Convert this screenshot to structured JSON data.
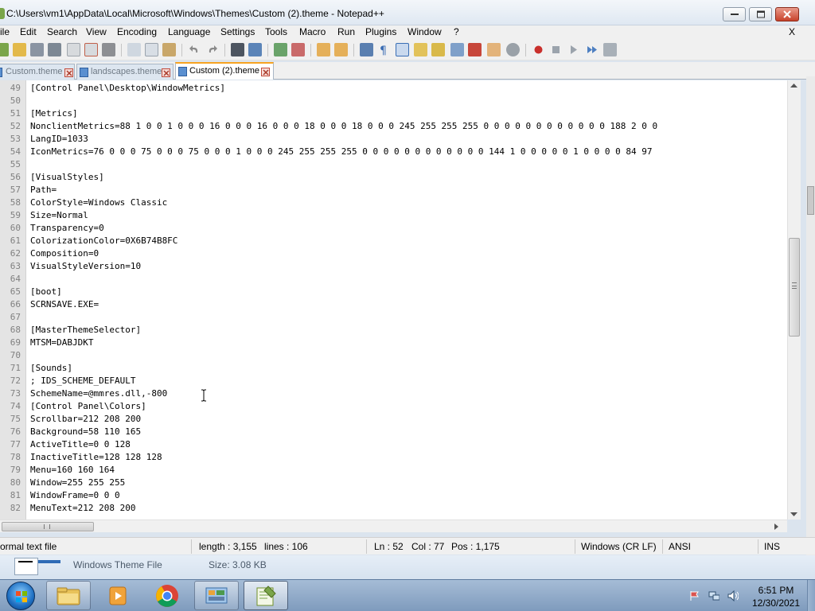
{
  "window": {
    "title": "C:\\Users\\vm1\\AppData\\Local\\Microsoft\\Windows\\Themes\\Custom (2).theme - Notepad++"
  },
  "menu": {
    "items": [
      "ile",
      "Edit",
      "Search",
      "View",
      "Encoding",
      "Language",
      "Settings",
      "Tools",
      "Macro",
      "Run",
      "Plugins",
      "Window",
      "?"
    ],
    "close_doc": "X"
  },
  "tabs": [
    {
      "label": "Custom.theme",
      "active": false
    },
    {
      "label": "landscapes.theme",
      "active": false
    },
    {
      "label": "Custom (2).theme",
      "active": true
    }
  ],
  "editor": {
    "lines": [
      {
        "num": "49",
        "text": "[Control Panel\\Desktop\\WindowMetrics]"
      },
      {
        "num": "50",
        "text": ""
      },
      {
        "num": "51",
        "text": "[Metrics]"
      },
      {
        "num": "52",
        "text": "NonclientMetrics=88 1 0 0 1 0 0 0 16 0 0 0 16 0 0 0 18 0 0 0 18 0 0 0 245 255 255 255 0 0 0 0 0 0 0 0 0 0 0 0 188 2 0 0"
      },
      {
        "num": "53",
        "text": "LangID=1033"
      },
      {
        "num": "54",
        "text": "IconMetrics=76 0 0 0 75 0 0 0 75 0 0 0 1 0 0 0 245 255 255 255 0 0 0 0 0 0 0 0 0 0 0 0 144 1 0 0 0 0 0 1 0 0 0 0 84 97"
      },
      {
        "num": "55",
        "text": ""
      },
      {
        "num": "56",
        "text": "[VisualStyles]"
      },
      {
        "num": "57",
        "text": "Path="
      },
      {
        "num": "58",
        "text": "ColorStyle=Windows Classic"
      },
      {
        "num": "59",
        "text": "Size=Normal"
      },
      {
        "num": "60",
        "text": "Transparency=0"
      },
      {
        "num": "61",
        "text": "ColorizationColor=0X6B74B8FC"
      },
      {
        "num": "62",
        "text": "Composition=0"
      },
      {
        "num": "63",
        "text": "VisualStyleVersion=10"
      },
      {
        "num": "64",
        "text": ""
      },
      {
        "num": "65",
        "text": "[boot]"
      },
      {
        "num": "66",
        "text": "SCRNSAVE.EXE="
      },
      {
        "num": "67",
        "text": ""
      },
      {
        "num": "68",
        "text": "[MasterThemeSelector]"
      },
      {
        "num": "69",
        "text": "MTSM=DABJDKT"
      },
      {
        "num": "70",
        "text": ""
      },
      {
        "num": "71",
        "text": "[Sounds]"
      },
      {
        "num": "72",
        "text": "; IDS_SCHEME_DEFAULT"
      },
      {
        "num": "73",
        "text": "SchemeName=@mmres.dll,-800"
      },
      {
        "num": "74",
        "text": "[Control Panel\\Colors]"
      },
      {
        "num": "75",
        "text": "Scrollbar=212 208 200"
      },
      {
        "num": "76",
        "text": "Background=58 110 165"
      },
      {
        "num": "77",
        "text": "ActiveTitle=0 0 128"
      },
      {
        "num": "78",
        "text": "InactiveTitle=128 128 128"
      },
      {
        "num": "79",
        "text": "Menu=160 160 164"
      },
      {
        "num": "80",
        "text": "Window=255 255 255"
      },
      {
        "num": "81",
        "text": "WindowFrame=0 0 0"
      },
      {
        "num": "82",
        "text": "MenuText=212 208 200"
      }
    ]
  },
  "status": {
    "filetype": "ormal text file",
    "length": "length : 3,155",
    "lines": "lines : 106",
    "ln": "Ln : 52",
    "col": "Col : 77",
    "pos": "Pos : 1,175",
    "eol": "Windows (CR LF)",
    "encoding": "ANSI",
    "mode": "INS"
  },
  "details": {
    "type": "Windows Theme File",
    "size": "Size: 3.08 KB"
  },
  "taskbar": {
    "time": "6:51 PM",
    "date": "12/30/2021"
  },
  "colors": {
    "tab_active_accent": "#f7a321",
    "gutter_bg": "#e4e4e4",
    "taskbar_bg": "#8fa9c9"
  },
  "icons": {
    "start": "windows-start-orb-icon",
    "explorer": "folder-icon",
    "media": "media-player-icon",
    "browser": "chrome-icon",
    "control_panel": "control-panel-icon",
    "notepadpp": "notepad-plus-plus-icon"
  }
}
